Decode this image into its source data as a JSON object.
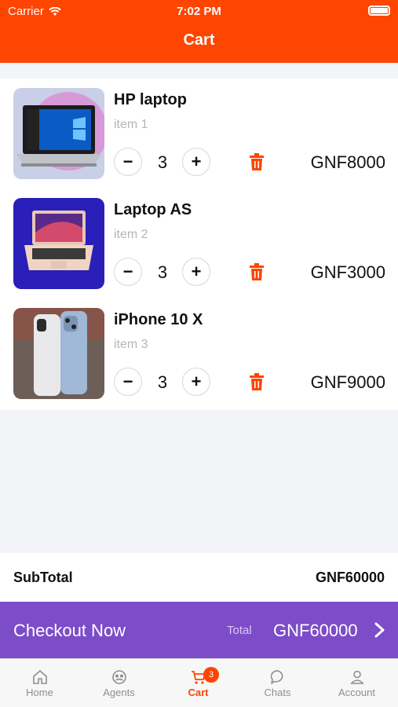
{
  "status_bar": {
    "carrier": "Carrier",
    "time": "7:02 PM"
  },
  "header": {
    "title": "Cart"
  },
  "cart": {
    "items": [
      {
        "name": "HP laptop",
        "subtitle": "item 1",
        "quantity": "3",
        "price": "GNF8000",
        "image": "hp-laptop-image"
      },
      {
        "name": "Laptop AS",
        "subtitle": "item 2",
        "quantity": "3",
        "price": "GNF3000",
        "image": "macbook-image"
      },
      {
        "name": "iPhone 10 X",
        "subtitle": "item 3",
        "quantity": "3",
        "price": "GNF9000",
        "image": "iphone-image"
      }
    ],
    "minus_label": "−",
    "plus_label": "+"
  },
  "summary": {
    "subtotal_label": "SubTotal",
    "subtotal_value": "GNF60000"
  },
  "checkout": {
    "label": "Checkout Now",
    "total_label": "Total",
    "total_value": "GNF60000"
  },
  "tabbar": {
    "tabs": [
      {
        "label": "Home",
        "icon": "home-icon"
      },
      {
        "label": "Agents",
        "icon": "agents-icon"
      },
      {
        "label": "Cart",
        "icon": "cart-icon",
        "badge": "3",
        "active": true
      },
      {
        "label": "Chats",
        "icon": "chat-icon"
      },
      {
        "label": "Account",
        "icon": "account-icon"
      }
    ]
  },
  "colors": {
    "brand": "#fe4502",
    "checkout": "#7d4cc8"
  }
}
